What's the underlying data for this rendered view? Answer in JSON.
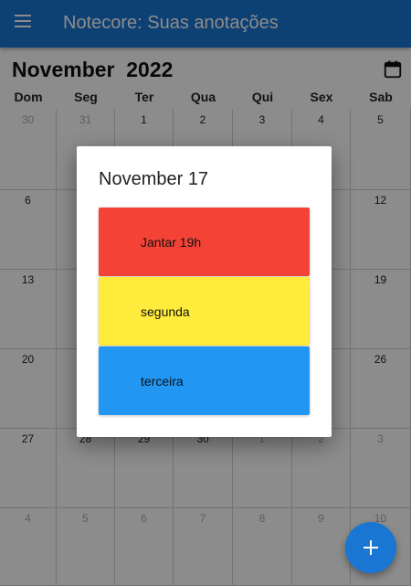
{
  "appbar": {
    "title": "Notecore: Suas anotações",
    "menu_icon": "menu-icon",
    "color": "#1976d2"
  },
  "calendar": {
    "month_title": "November  2022",
    "picker_icon": "calendar-icon",
    "weekdays": [
      "Dom",
      "Seg",
      "Ter",
      "Qua",
      "Qui",
      "Sex",
      "Sab"
    ],
    "weeks": [
      [
        "30",
        "31",
        "1",
        "2",
        "3",
        "4",
        "5"
      ],
      [
        "6",
        "",
        "",
        "",
        "",
        "",
        "12"
      ],
      [
        "13",
        "",
        "",
        "",
        "",
        "",
        "19"
      ],
      [
        "20",
        "",
        "",
        "",
        "",
        "",
        "26"
      ],
      [
        "27",
        "28",
        "29",
        "30",
        "1",
        "2",
        "3"
      ],
      [
        "4",
        "5",
        "6",
        "7",
        "8",
        "9",
        "10"
      ]
    ],
    "weeks_in_month": [
      [
        false,
        false,
        true,
        true,
        true,
        true,
        true
      ],
      [
        true,
        true,
        true,
        true,
        true,
        true,
        true
      ],
      [
        true,
        true,
        true,
        true,
        true,
        true,
        true
      ],
      [
        true,
        true,
        true,
        true,
        true,
        true,
        true
      ],
      [
        true,
        true,
        true,
        true,
        false,
        false,
        false
      ],
      [
        false,
        false,
        false,
        false,
        false,
        false,
        false
      ]
    ]
  },
  "dialog": {
    "title": "November 17",
    "notes": [
      {
        "label": "Jantar 19h",
        "color": "#f44336"
      },
      {
        "label": "segunda",
        "color": "#ffeb3b"
      },
      {
        "label": "terceira",
        "color": "#2196f3"
      }
    ]
  },
  "fab": {
    "icon": "add-icon"
  }
}
